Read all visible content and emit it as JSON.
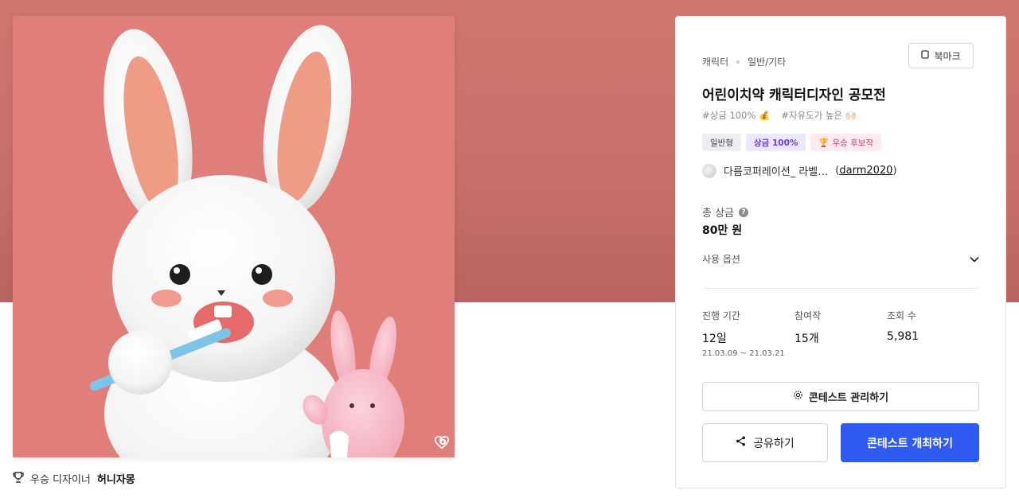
{
  "artwork": {
    "like_count": "6",
    "winner_prefix": "우승 디자이너",
    "winner_name": "허니자몽"
  },
  "panel": {
    "category": "캐릭터",
    "subcategory": "일반/기타",
    "bookmark_label": "북마크",
    "title": "어린이치약 캐릭터디자인 공모전",
    "hashtags": [
      "#상금 100% 💰",
      "#자유도가 높은 🙌🏻"
    ],
    "badges": {
      "general": "일반형",
      "prize": "상금 100%",
      "winner": "우승 후보작"
    },
    "host_name": "다름코퍼레이션_ 라벨…",
    "host_handle": "darm2020",
    "prize_label": "총 상금",
    "prize_value": "80만 원",
    "options_label": "사용 옵션",
    "stats": {
      "period_label": "진행 기간",
      "period_value": "12일",
      "period_range": "21.03.09 ~ 21.03.21",
      "entries_label": "참여작",
      "entries_value": "15개",
      "views_label": "조회 수",
      "views_value": "5,981"
    },
    "manage_label": "콘테스트 관리하기",
    "share_label": "공유하기",
    "host_contest_label": "콘테스트 개최하기"
  },
  "colors": {
    "hero": "#cf7670",
    "artwork_bg": "#e07f79",
    "primary": "#2f5bf0",
    "prize_badge": "#ece6ff",
    "winner_badge": "#fde9f0"
  }
}
